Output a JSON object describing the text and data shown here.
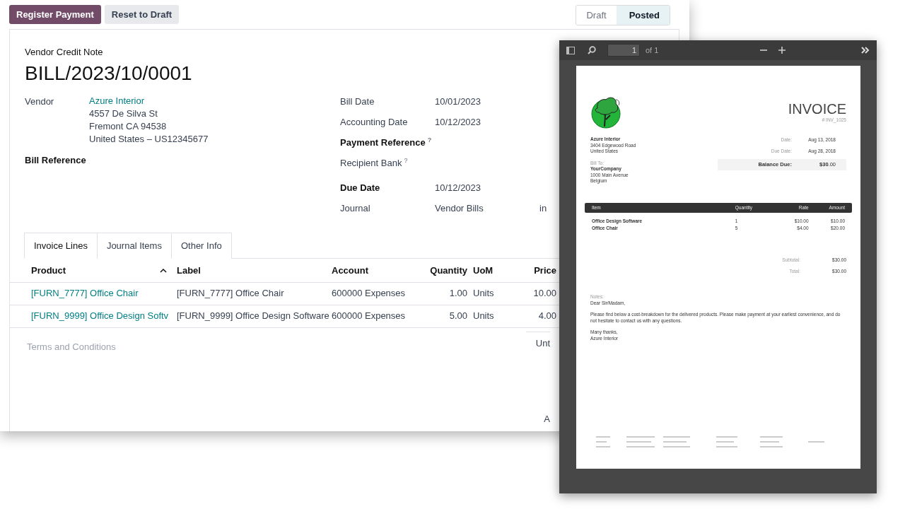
{
  "actions": [
    {
      "label": "Register Payment",
      "kind": "primary"
    },
    {
      "label": "Reset to Draft",
      "kind": "secondary"
    }
  ],
  "status_steps": [
    {
      "label": "Draft",
      "selected": false
    },
    {
      "label": "Posted",
      "selected": true
    }
  ],
  "form": {
    "type_label": "Vendor Credit Note",
    "title": "BILL/2023/10/0001",
    "vendor": {
      "label": "Vendor",
      "name": "Azure Interior",
      "address": [
        "4557 De Silva St",
        "Fremont CA 94538",
        "United States – US12345677"
      ]
    },
    "bill_reference": {
      "label": "Bill Reference"
    },
    "right_fields": [
      {
        "label": "Bill Date",
        "value": "10/01/2023",
        "emphasis": false
      },
      {
        "label": "Accounting Date",
        "value": "10/12/2023",
        "emphasis": false
      },
      {
        "label": "Payment Reference",
        "help": "?",
        "emphasis": true
      },
      {
        "label": "Recipient Bank",
        "help": "?",
        "emphasis": false
      },
      {
        "label": "Due Date",
        "value": "10/12/2023",
        "emphasis": true
      },
      {
        "label": "Journal",
        "value": "Vendor Bills",
        "extra": "in",
        "emphasis": false
      }
    ]
  },
  "tabs": [
    {
      "label": "Invoice Lines",
      "selected": true
    },
    {
      "label": "Journal Items",
      "selected": false
    },
    {
      "label": "Other Info",
      "selected": false
    }
  ],
  "table": {
    "columns": [
      {
        "label": "Product",
        "sorted": true,
        "kind": "text"
      },
      {
        "label": "Label",
        "sorted": false,
        "kind": "text"
      },
      {
        "label": "Account",
        "sorted": false,
        "kind": "text"
      },
      {
        "label": "Quantity",
        "sorted": false,
        "kind": "number"
      },
      {
        "label": "UoM",
        "sorted": false,
        "kind": "text"
      },
      {
        "label": "Price",
        "sorted": false,
        "kind": "number"
      }
    ],
    "rows": [
      [
        "[FURN_7777] Office Chair",
        "[FURN_7777] Office Chair",
        "600000 Expenses",
        "1.00",
        "Units",
        "10.00"
      ],
      [
        "[FURN_9999] Office Design Softv",
        "[FURN_9999] Office Design Software",
        "600000 Expenses",
        "5.00",
        "Units",
        "4.00"
      ]
    ]
  },
  "terms_placeholder": "Terms and Conditions",
  "totals_fragments": [
    "Unt",
    "A"
  ],
  "viewer": {
    "page_number": "1",
    "page_count": "of 1",
    "invoice": {
      "title": "INVOICE",
      "number": "# INV_1025",
      "from": {
        "name": "Azure Interior",
        "lines": [
          "3404 Edgewood Road",
          "United States"
        ]
      },
      "bill_to_label": "Bill To:",
      "bill_to": {
        "name": "YourCompany",
        "lines": [
          "1000 Main Avenue",
          "Belgium"
        ]
      },
      "meta": [
        {
          "label": "Date:",
          "value": "Aug 13, 2018"
        },
        {
          "label": "Due Date:",
          "value": "Aug 28, 2018"
        }
      ],
      "balance": {
        "label": "Balance Due:",
        "value": "**$30**.00"
      },
      "columns": [
        "Item",
        "Quantity",
        "Rate",
        "Amount"
      ],
      "items": [
        [
          "Office Design Software",
          "1",
          "$10.00",
          "$10.00"
        ],
        [
          "Office Chair",
          "5",
          "$4.00",
          "$20.00"
        ]
      ],
      "totals": [
        {
          "label": "Subtotal:",
          "value": "$30.00"
        },
        {
          "label": "Total:",
          "value": "$30.00"
        }
      ],
      "notes_label": "Notes:",
      "notes": [
        [
          "Dear Sir/Madam,"
        ],
        [
          "Please find below a cost-breakdown for the delivered products. Please make payment at your earliest convenience, and do not hesitate to contact us with any questions."
        ],
        [
          "Many thanks,",
          "Azure Interior"
        ]
      ]
    }
  }
}
